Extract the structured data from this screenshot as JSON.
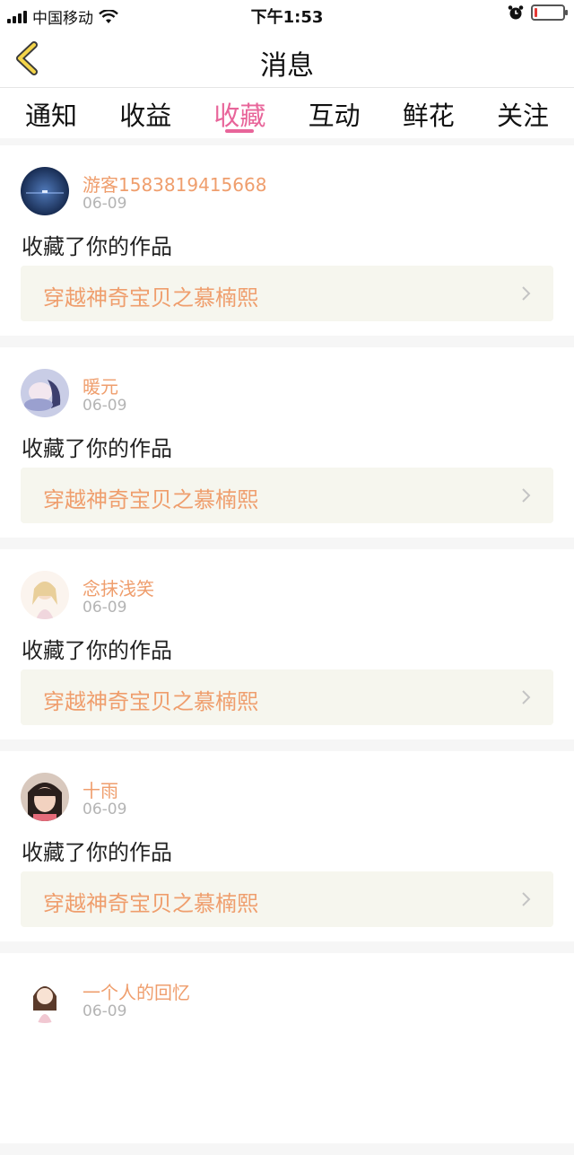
{
  "status_bar": {
    "carrier": "中国移动",
    "time": "下午1:53",
    "battery_level": 0.1,
    "battery_color": "#e53935"
  },
  "header": {
    "title": "消息",
    "back_icon": "chevron-left-icon"
  },
  "tabs": [
    {
      "label": "通知",
      "active": false
    },
    {
      "label": "收益",
      "active": false
    },
    {
      "label": "收藏",
      "active": true
    },
    {
      "label": "互动",
      "active": false
    },
    {
      "label": "鲜花",
      "active": false
    },
    {
      "label": "关注",
      "active": false
    }
  ],
  "colors": {
    "accent": "#e8659a",
    "name": "#ef9e6d",
    "date": "#b4b4b4",
    "work_bg": "#f6f6ee"
  },
  "items": [
    {
      "username": "游客1583819415668",
      "date": "06-09",
      "action": "收藏了你的作品",
      "work_title": "穿越神奇宝贝之慕楠熙",
      "avatar": "night-sea-avatar"
    },
    {
      "username": "暖元",
      "date": "06-09",
      "action": "收藏了你的作品",
      "work_title": "穿越神奇宝贝之慕楠熙",
      "avatar": "anime-girl-avatar"
    },
    {
      "username": "念抹浅笑",
      "date": "06-09",
      "action": "收藏了你的作品",
      "work_title": "穿越神奇宝贝之慕楠熙",
      "avatar": "illustration-girl-avatar"
    },
    {
      "username": "十雨",
      "date": "06-09",
      "action": "收藏了你的作品",
      "work_title": "穿越神奇宝贝之慕楠熙",
      "avatar": "child-photo-avatar"
    },
    {
      "username": "一个人的回忆",
      "date": "06-09",
      "action": "",
      "work_title": "",
      "avatar": "chibi-girl-avatar"
    }
  ]
}
